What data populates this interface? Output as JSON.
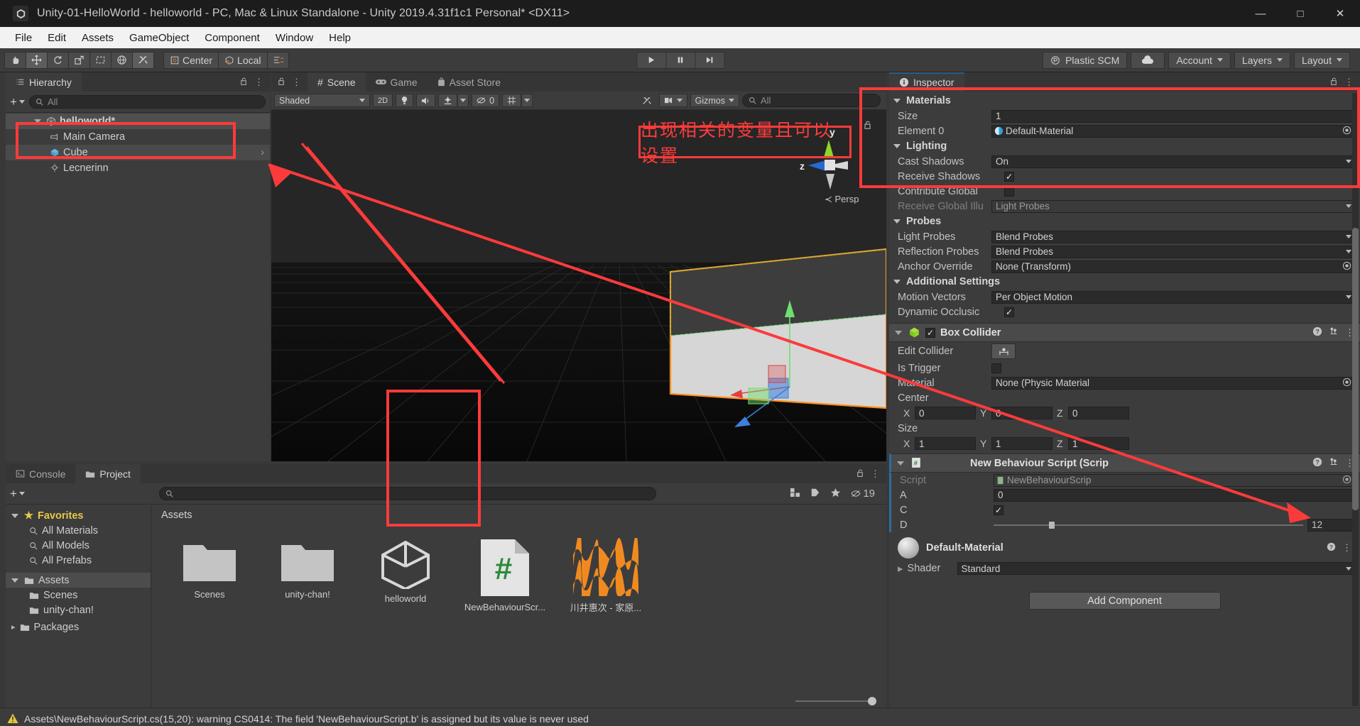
{
  "window": {
    "title": "Unity-01-HelloWorld - helloworld - PC, Mac & Linux Standalone - Unity 2019.4.31f1c1 Personal* <DX11>",
    "minimize": "—",
    "maximize": "□",
    "close": "✕",
    "logo_icon": "unity-logo-icon"
  },
  "menu": [
    "File",
    "Edit",
    "Assets",
    "GameObject",
    "Component",
    "Window",
    "Help"
  ],
  "toolbar": {
    "tools": [
      "hand-tool-icon",
      "move-tool-icon",
      "rotate-tool-icon",
      "scale-tool-icon",
      "rect-tool-icon",
      "transform-tool-icon",
      "custom-tool-icon"
    ],
    "pivot_label": "Center",
    "space_label": "Local",
    "grid_snap_icon": "grid-snap-icon",
    "play": "▶",
    "pause": "❙❙",
    "step": "▶❘",
    "plastic_scm": "Plastic SCM",
    "cloud_icon": "cloud-icon",
    "account": "Account",
    "layers": "Layers",
    "layout": "Layout"
  },
  "hierarchy": {
    "tab": "Hierarchy",
    "search_placeholder": "All",
    "items": [
      {
        "label": "helloworld*",
        "depth": 0,
        "icon": "scene-icon",
        "expanded": true
      },
      {
        "label": "Main Camera",
        "depth": 1,
        "icon": "camera-icon",
        "expanded": false
      },
      {
        "label": "Cube",
        "depth": 1,
        "icon": "cube-icon",
        "expanded": false,
        "selected": true
      },
      {
        "label": "Lecnerinn",
        "depth": 1,
        "icon": "light-icon",
        "expanded": false
      }
    ]
  },
  "scene": {
    "tabs": [
      {
        "label": "Scene",
        "icon": "scene-tab-icon",
        "active": true
      },
      {
        "label": "Game",
        "icon": "game-tab-icon",
        "active": false
      },
      {
        "label": "Asset Store",
        "icon": "asset-store-icon",
        "active": false
      }
    ],
    "shading_mode": "Shaded",
    "mode_2d": "2D",
    "lighting_icon": "lighting-icon",
    "audio_icon": "audio-icon",
    "fx_icon": "fx-icon",
    "hidden_count": "0",
    "grid_icon": "grid-icon",
    "tools_icon": "scene-tools-icon",
    "camera_icon": "scene-camera-icon",
    "gizmos": "Gizmos",
    "search_placeholder": "All",
    "axis_y": "y",
    "axis_z": "z",
    "persp_label": "Persp"
  },
  "inspector": {
    "tab": "Inspector",
    "sections": {
      "materials": {
        "title": "Materials",
        "rows": [
          {
            "label": "Size",
            "value": "1",
            "type": "text"
          },
          {
            "label": "Element 0",
            "value": "Default-Material",
            "type": "object"
          }
        ]
      },
      "lighting": {
        "title": "Lighting",
        "rows": [
          {
            "label": "Cast Shadows",
            "value": "On",
            "type": "dropdown"
          },
          {
            "label": "Receive Shadows",
            "value": "",
            "type": "check",
            "checked": true
          },
          {
            "label": "Contribute Global",
            "value": "",
            "type": "check",
            "checked": false
          },
          {
            "label": "Receive Global Illu",
            "value": "Light Probes",
            "type": "dropdown",
            "dim": true
          }
        ]
      },
      "probes": {
        "title": "Probes",
        "rows": [
          {
            "label": "Light Probes",
            "value": "Blend Probes",
            "type": "dropdown"
          },
          {
            "label": "Reflection Probes",
            "value": "Blend Probes",
            "type": "dropdown"
          },
          {
            "label": "Anchor Override",
            "value": "None (Transform)",
            "type": "object"
          }
        ]
      },
      "additional": {
        "title": "Additional Settings",
        "rows": [
          {
            "label": "Motion Vectors",
            "value": "Per Object Motion",
            "type": "dropdown"
          },
          {
            "label": "Dynamic Occlusic",
            "value": "",
            "type": "check",
            "checked": true
          }
        ]
      }
    },
    "box_collider": {
      "title": "Box Collider",
      "icon": "box-collider-icon",
      "enabled": true,
      "rows": [
        {
          "label": "Edit Collider",
          "value": "",
          "type": "editbtn"
        },
        {
          "label": "Is Trigger",
          "value": "",
          "type": "check",
          "checked": false
        },
        {
          "label": "Material",
          "value": "None (Physic Material",
          "type": "object"
        }
      ],
      "center_label": "Center",
      "center": {
        "x": "0",
        "y": "0",
        "z": "0"
      },
      "size_label": "Size",
      "size": {
        "x": "1",
        "y": "1",
        "z": "1"
      }
    },
    "script_component": {
      "title": "New Behaviour Script (Scrip",
      "icon": "cs-script-icon",
      "rows": [
        {
          "label": "Script",
          "value": "NewBehaviourScrip",
          "type": "object",
          "dim": true
        },
        {
          "label": "A",
          "value": "0",
          "type": "text"
        },
        {
          "label": "C",
          "value": "",
          "type": "check",
          "checked": true
        },
        {
          "label": "D",
          "value": "12",
          "type": "slider",
          "slider_pct": 18
        }
      ]
    },
    "material_preview": {
      "name": "Default-Material",
      "shader_label": "Shader",
      "shader_value": "Standard"
    },
    "add_component": "Add Component"
  },
  "project": {
    "tabs": [
      {
        "label": "Console",
        "icon": "console-icon",
        "active": false
      },
      {
        "label": "Project",
        "icon": "project-icon",
        "active": true
      }
    ],
    "search_placeholder": "",
    "hidden_count": "19",
    "favorites_title": "Favorites",
    "favorites": [
      "All Materials",
      "All Models",
      "All Prefabs"
    ],
    "assets_title": "Assets",
    "tree": [
      {
        "label": "Assets",
        "depth": 0,
        "selected": true,
        "icon": "folder-icon"
      },
      {
        "label": "Scenes",
        "depth": 1,
        "icon": "folder-icon"
      },
      {
        "label": "unity-chan!",
        "depth": 1,
        "icon": "folder-icon"
      },
      {
        "label": "Packages",
        "depth": 0,
        "icon": "folder-icon"
      }
    ],
    "breadcrumb": "Assets",
    "assets": [
      {
        "name": "Scenes",
        "type": "folder"
      },
      {
        "name": "unity-chan!",
        "type": "folder"
      },
      {
        "name": "helloworld",
        "type": "unity-scene"
      },
      {
        "name": "NewBehaviourScr...",
        "type": "cs-script"
      },
      {
        "name": "川井惠次 - 家原...",
        "type": "audio"
      }
    ],
    "zoom_icons": [
      "prefab-icon",
      "label-icon",
      "favorite-icon"
    ]
  },
  "annotations": {
    "note_text": "出现相关的变量且可以设置",
    "accent_color": "#fb3b3b"
  },
  "statusbar": {
    "warning_icon": "warning-icon",
    "message": "Assets\\NewBehaviourScript.cs(15,20): warning CS0414: The field 'NewBehaviourScript.b' is assigned but its value is never used"
  }
}
